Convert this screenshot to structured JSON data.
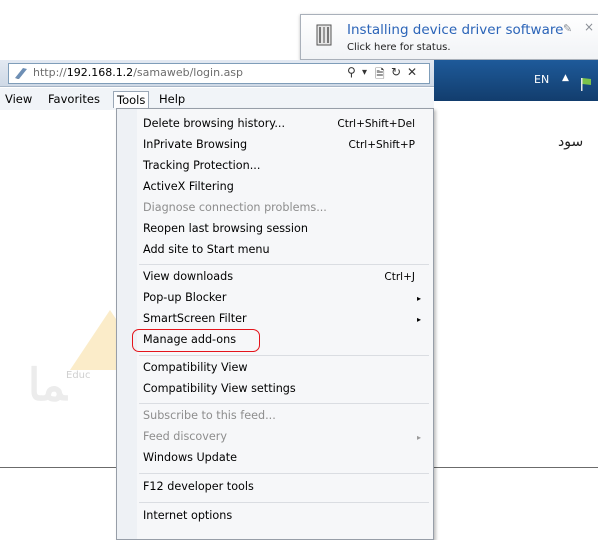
{
  "notification": {
    "title": "Installing device driver software",
    "subtitle": "Click here for status.",
    "pin_icon": "✎",
    "close_icon": "×"
  },
  "taskbar": {
    "language": "EN",
    "tray_arrow": "▲"
  },
  "address_bar": {
    "url_protocol": "http://",
    "url_host": "192.168.1.2",
    "url_path": "/samaweb/login.asp",
    "search_icon": "⚲",
    "dropdown_icon": "▾",
    "compat_icon": "🗎",
    "refresh_icon": "↻",
    "stop_icon": "✕"
  },
  "menubar": {
    "view": "View",
    "favorites": "Favorites",
    "tools": "Tools",
    "help": "Help"
  },
  "tools_menu": {
    "delete_history": "Delete browsing history...",
    "delete_history_shortcut": "Ctrl+Shift+Del",
    "inprivate": "InPrivate Browsing",
    "inprivate_shortcut": "Ctrl+Shift+P",
    "tracking_protection": "Tracking Protection...",
    "activex_filtering": "ActiveX Filtering",
    "diagnose": "Diagnose connection problems...",
    "reopen": "Reopen last browsing session",
    "add_site": "Add site to Start menu",
    "view_downloads": "View downloads",
    "view_downloads_shortcut": "Ctrl+J",
    "popup_blocker": "Pop-up Blocker",
    "smartscreen": "SmartScreen Filter",
    "manage_addons": "Manage add-ons",
    "compat_view": "Compatibility View",
    "compat_view_settings": "Compatibility View settings",
    "subscribe": "Subscribe to this feed...",
    "feed_discovery": "Feed discovery",
    "windows_update": "Windows Update",
    "f12_tools": "F12 developer tools",
    "internet_options": "Internet options",
    "submenu_arrow": "▸"
  },
  "page": {
    "rtl_text": "سود"
  },
  "watermark": {
    "text": "Educ"
  },
  "colors": {
    "highlight": "#e4141b",
    "notification_title": "#2b64b8",
    "taskbar": "#1e5a9a"
  }
}
